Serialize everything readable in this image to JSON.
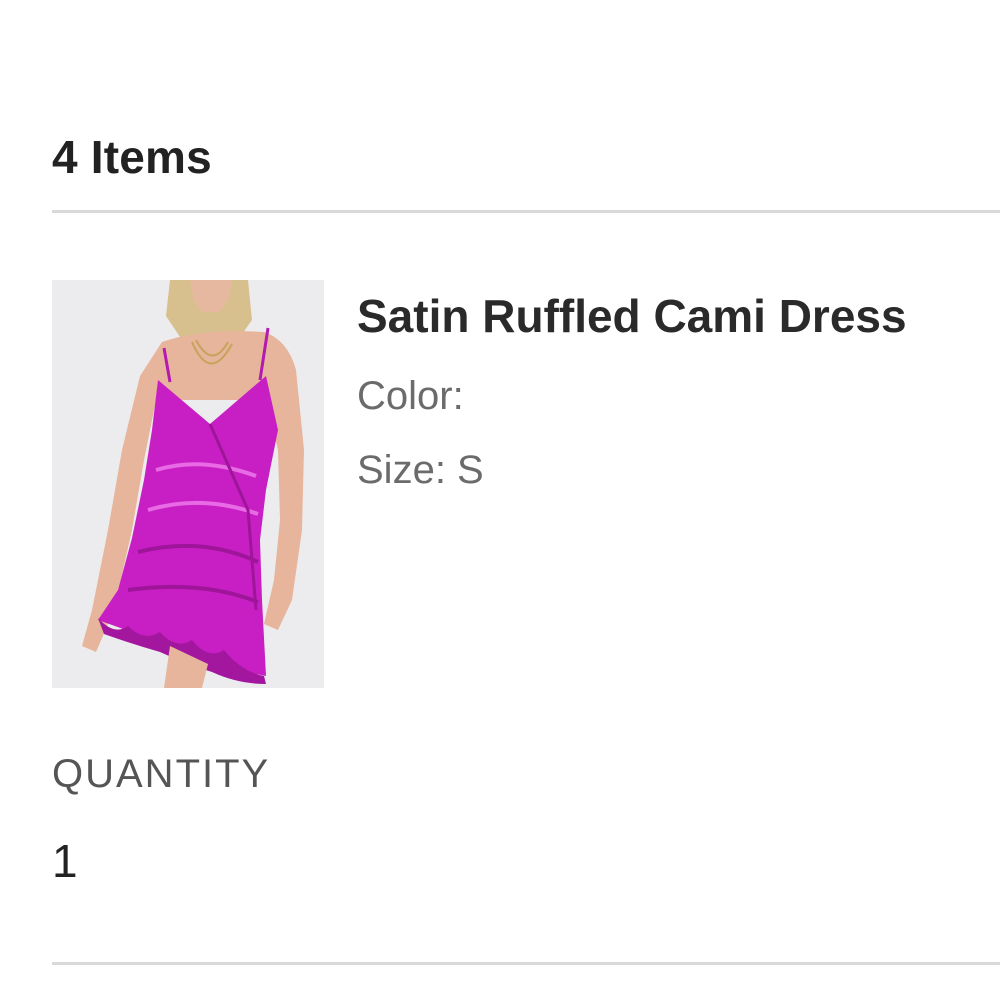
{
  "cart": {
    "items_count_label": "4 Items"
  },
  "item": {
    "name": "Satin Ruffled Cami Dress",
    "color_label": "Color:",
    "size_label": "Size: S",
    "image_icon": "product-photo-dress",
    "dress_color": "#c81fc4"
  },
  "quantity": {
    "label": "QUANTITY",
    "value": "1"
  }
}
